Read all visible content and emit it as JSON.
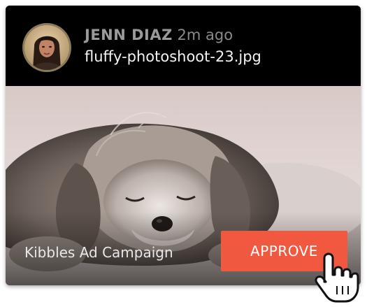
{
  "post": {
    "author": "JENN DIAZ",
    "time_ago": "2m ago",
    "filename": "fluffy-photoshoot-23.jpg"
  },
  "campaign": {
    "label": "Kibbles Ad Campaign"
  },
  "actions": {
    "approve_label": "APPROVE"
  },
  "colors": {
    "accent": "#f0583f",
    "header_bg": "#000000",
    "author_text": "#9a9a9a",
    "filename_text": "#f2f2f2"
  },
  "icons": {
    "cursor": "hand-pointer-icon",
    "avatar": "avatar"
  }
}
